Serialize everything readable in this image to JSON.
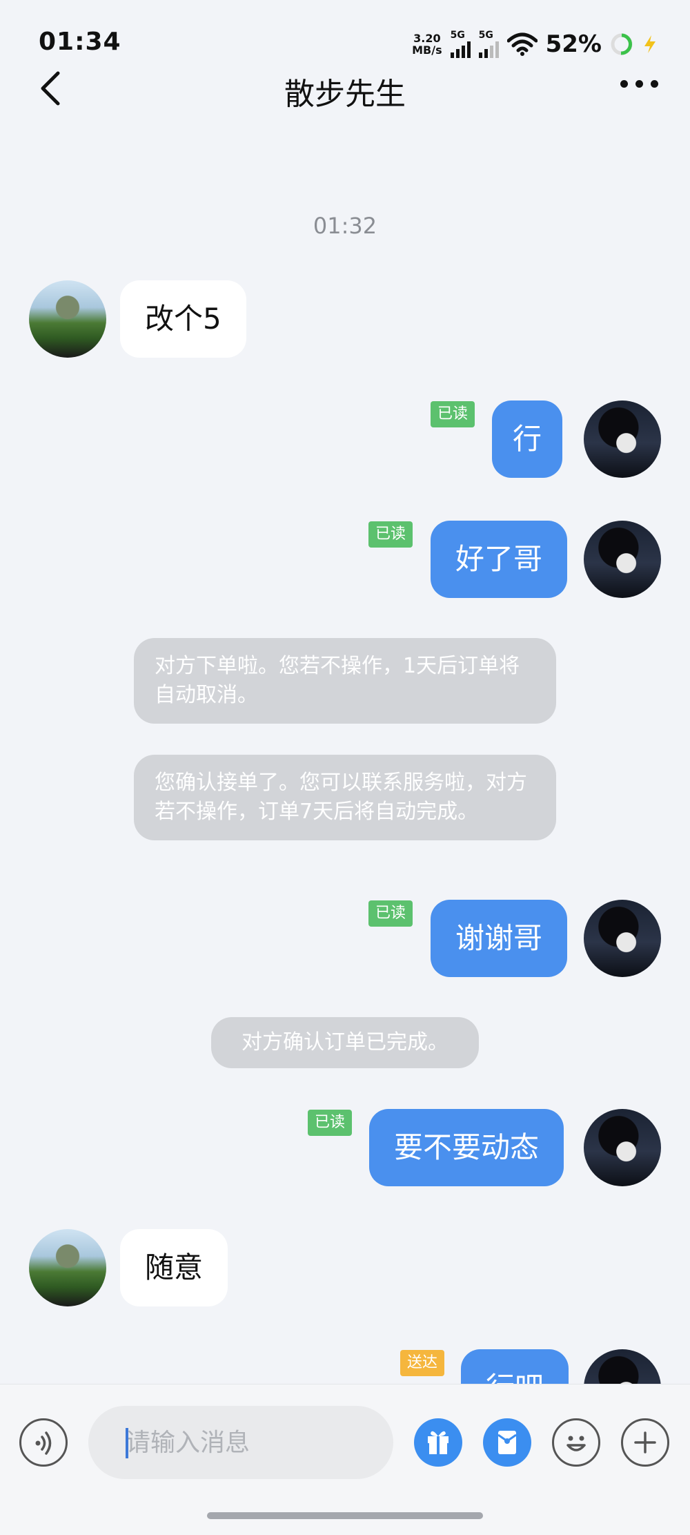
{
  "status_bar": {
    "time": "01:34",
    "net_speed_value": "3.20",
    "net_speed_unit": "MB/s",
    "signal1_label": "5G",
    "signal2_label": "5G",
    "battery": "52%"
  },
  "header": {
    "title": "散步先生",
    "back_icon": "chevron-left-icon",
    "more_icon": "more-dots-icon"
  },
  "chat": {
    "timestamp": "01:32",
    "messages": [
      {
        "side": "in",
        "text": "改个5"
      },
      {
        "side": "out",
        "text": "行",
        "status": "已读"
      },
      {
        "side": "out",
        "text": "好了哥",
        "status": "已读"
      },
      {
        "side": "system",
        "text": "对方下单啦。您若不操作，1天后订单将自动取消。"
      },
      {
        "side": "system",
        "text": "您确认接单了。您可以联系服务啦，对方若不操作，订单7天后将自动完成。"
      },
      {
        "side": "out",
        "text": "谢谢哥",
        "status": "已读"
      },
      {
        "side": "system",
        "text": "对方确认订单已完成。"
      },
      {
        "side": "out",
        "text": "要不要动态",
        "status": "已读"
      },
      {
        "side": "in",
        "text": "随意"
      },
      {
        "side": "out",
        "text": "行吧",
        "status": "送达"
      }
    ]
  },
  "input_bar": {
    "placeholder": "请输入消息",
    "icons": [
      "voice-icon",
      "gift-icon",
      "red-packet-icon",
      "emoji-icon",
      "plus-icon"
    ]
  },
  "colors": {
    "accent": "#4a90ee",
    "read_badge": "#5cc16e",
    "sending_badge": "#f5b63d",
    "system_bubble": "#d2d4d8",
    "background": "#f2f4f8"
  }
}
